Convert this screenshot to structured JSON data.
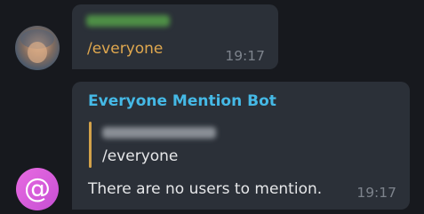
{
  "messages": [
    {
      "sender_name": "",
      "text": "/everyone",
      "time": "19:17"
    },
    {
      "sender_name": "Everyone Mention Bot",
      "reply_quote": {
        "sender_name": "",
        "text": "/everyone"
      },
      "text": "There are no users to mention.",
      "time": "19:17",
      "avatar_glyph": "@"
    }
  ],
  "colors": {
    "background": "#17191e",
    "bubble": "#2b3038",
    "bot_name": "#45b9e6",
    "command_highlight": "#e0a84f",
    "quote_bar": "#d3a24a",
    "bot_avatar": "#d55ad9"
  },
  "icons": {
    "user_avatar": "user-photo-avatar",
    "bot_avatar": "at-sign-avatar"
  }
}
